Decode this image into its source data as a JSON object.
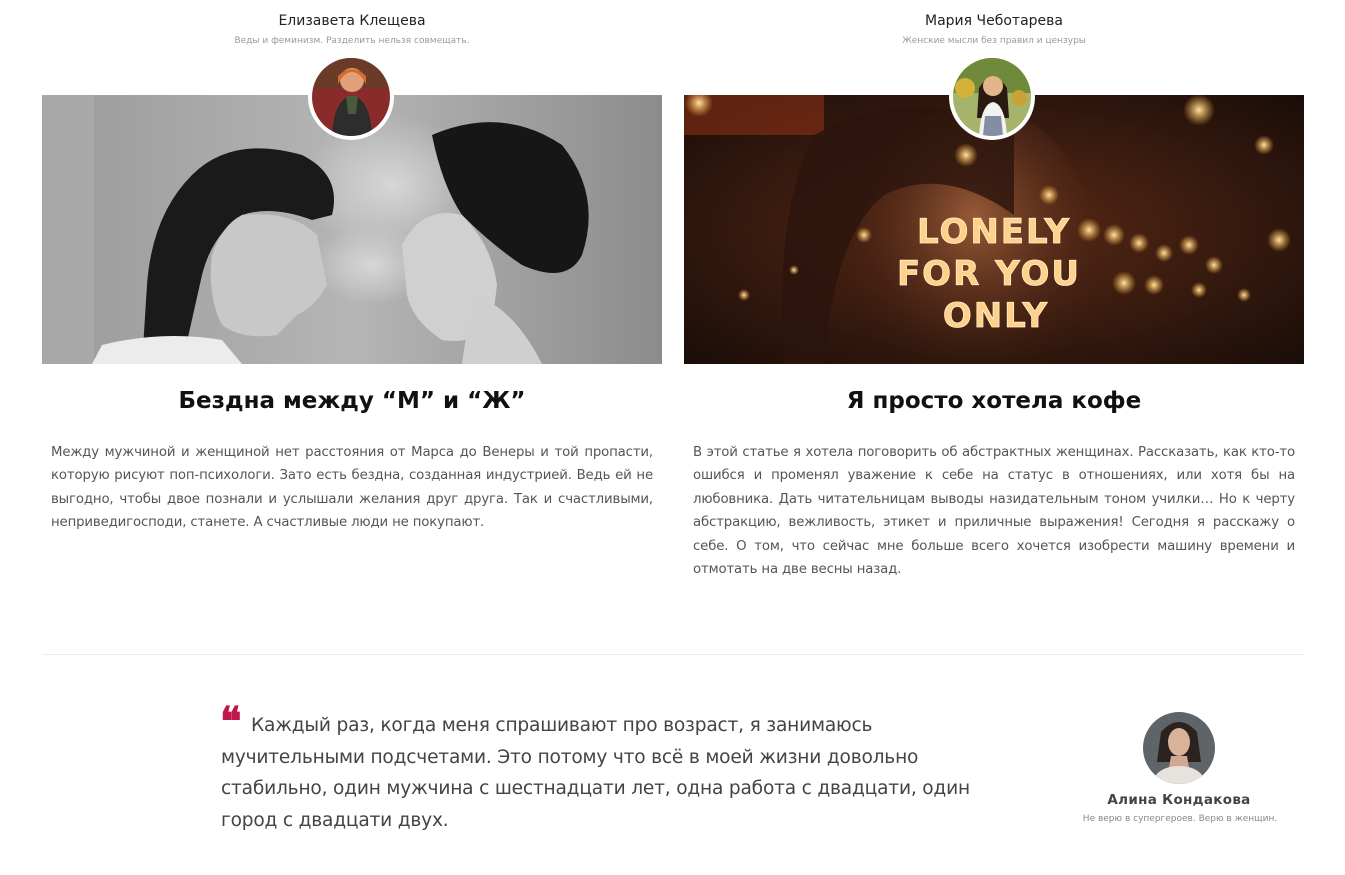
{
  "posts": [
    {
      "author_name": "Елизавета Клещева",
      "author_tagline": "Веды и феминизм. Разделить нельзя совмещать.",
      "title": "Бездна между “М” и “Ж”",
      "excerpt": "Между мужчиной и женщиной нет расстояния от Марса до Венеры и той пропасти, которую рисуют поп-психологи. Зато есть бездна, созданная индустрией. Ведь ей не выгодно, чтобы двое познали и услышали желания друг друга. Так и счастливыми, неприведигосподи, станете. А счастливые люди не покупают."
    },
    {
      "author_name": "Мария Чеботарева",
      "author_tagline": "Женские мысли без правил и цензуры",
      "title": "Я просто хотела кофе",
      "excerpt": "В этой статье я хотела поговорить об абстрактных женщинах. Рассказать, как кто-то ошибся и променял уважение к себе на статус в отношениях, или хотя бы на любовника. Дать читательницам выводы назидательным тоном училки… Но к черту абстракцию, вежливость, этикет и приличные выражения! Сегодня я расскажу о себе. О том, что сейчас мне больше всего хочется изобрести машину времени и отмотать на две весны назад.",
      "image_sign_lines": [
        "LONELY",
        "FOR YOU",
        "ONLY"
      ]
    }
  ],
  "quote": {
    "mark": "❝",
    "text": "Каждый раз, когда меня спрашивают про возраст, я занимаюсь мучительными подсчетами. Это потому что всё в моей жизни довольно стабильно, один мужчина с шестнадцати лет, одна работа с двадцати, один город с двадцати двух.",
    "author_name": "Алина Кондакова",
    "author_tagline": "Не верю в супергероев. Верю в женщин."
  },
  "colors": {
    "accent": "#c1184b",
    "title": "#111111",
    "body_text": "#555555",
    "muted": "#999999"
  }
}
